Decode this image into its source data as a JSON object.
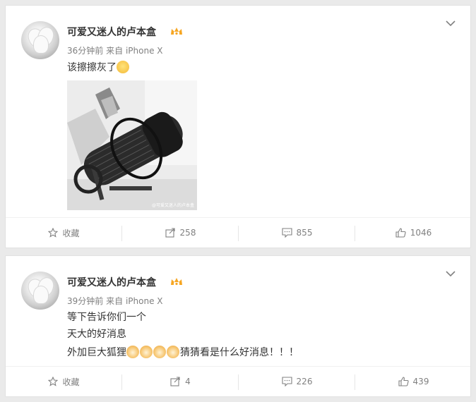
{
  "posts": [
    {
      "author": "可爱又迷人的卢本盒",
      "time": "36分钟前",
      "source_prefix": "来自",
      "source": "iPhone X",
      "lines": [
        "该擦擦灰了"
      ],
      "image_watermark": "@可爱又迷人的卢本盒",
      "actions": {
        "favorite": "收藏",
        "repost": "258",
        "comment": "855",
        "like": "1046"
      }
    },
    {
      "author": "可爱又迷人的卢本盒",
      "time": "39分钟前",
      "source_prefix": "来自",
      "source": "iPhone X",
      "lines": [
        "等下告诉你们一个",
        "天大的好消息",
        "外加巨大狐狸",
        "猜猜看是什么好消息！！！"
      ],
      "actions": {
        "favorite": "收藏",
        "repost": "4",
        "comment": "226",
        "like": "439"
      }
    }
  ],
  "icons": {
    "vip_badge": "vip-badge-icon",
    "chevron": "chevron-down-icon",
    "emoji_1": "shy-face-emoji-icon",
    "emoji_2": "fox-emoji-icon",
    "favorite": "star-icon",
    "repost": "share-icon",
    "comment": "comment-icon",
    "like": "thumbs-up-icon"
  },
  "colors": {
    "page_bg": "#eaeaea",
    "card_bg": "#ffffff",
    "text": "#333333",
    "muted": "#808080",
    "vip": "#f6a623"
  }
}
